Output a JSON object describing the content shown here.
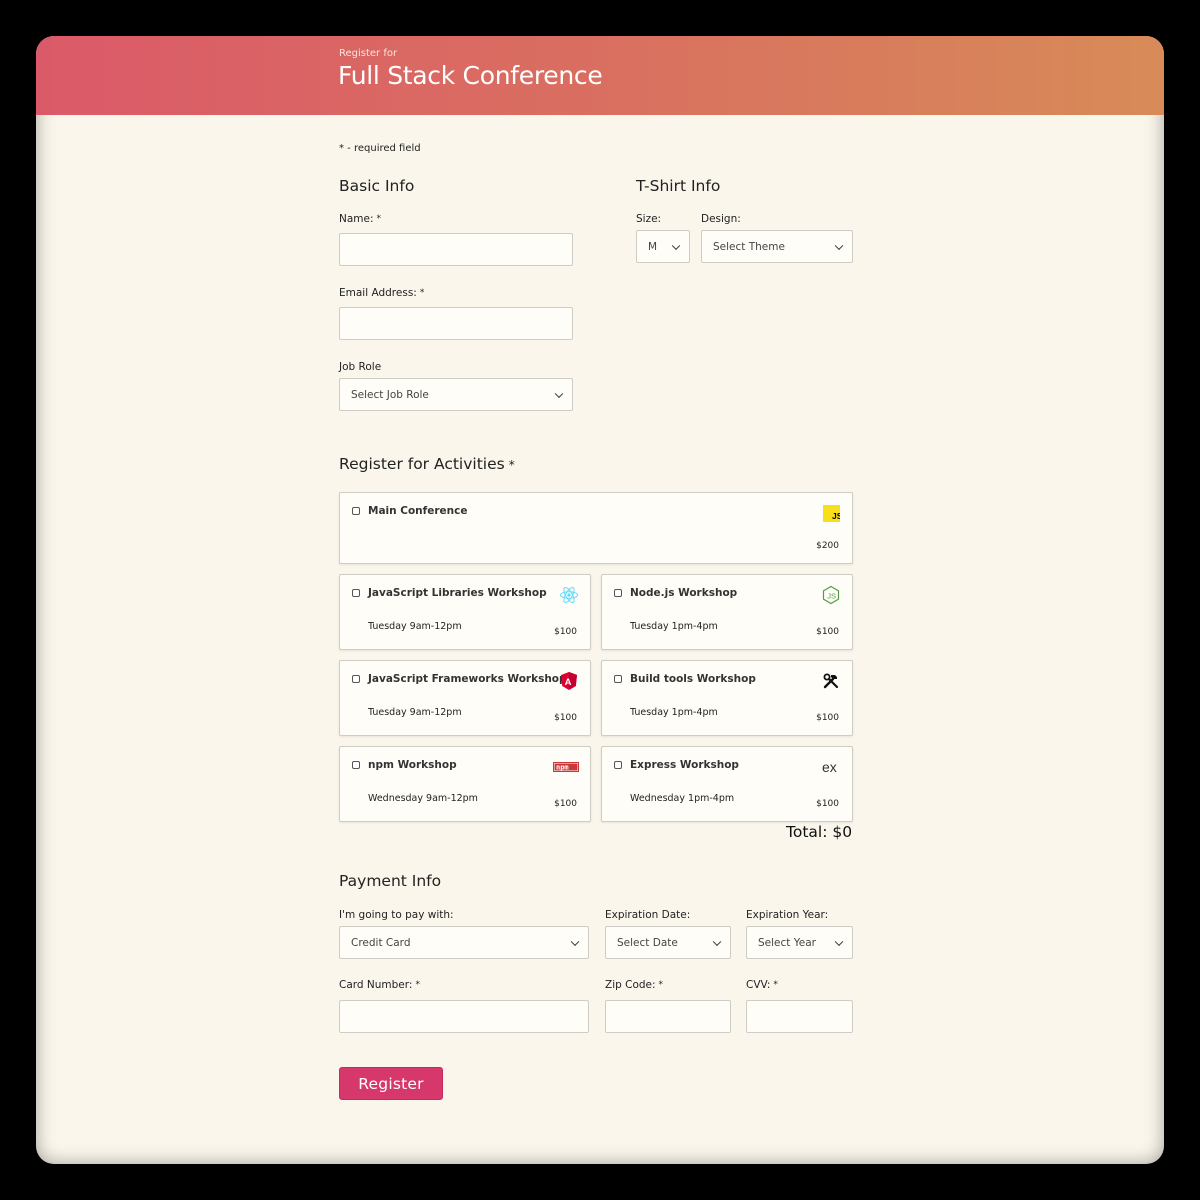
{
  "header": {
    "pre_title": "Register for",
    "title": "Full Stack Conference"
  },
  "required_note": "* - required field",
  "basic_info": {
    "title": "Basic Info",
    "name_label": "Name:",
    "email_label": "Email Address:",
    "job_role_label": "Job Role",
    "job_role_value": "Select Job Role"
  },
  "tshirt": {
    "title": "T-Shirt Info",
    "size_label": "Size:",
    "size_value": "M",
    "design_label": "Design:",
    "design_value": "Select Theme"
  },
  "activities": {
    "title": "Register for Activities",
    "items": [
      {
        "name": "Main Conference",
        "time": "",
        "price": "$200",
        "icon": "javascript-icon"
      },
      {
        "name": "JavaScript Libraries Workshop",
        "time": "Tuesday 9am-12pm",
        "price": "$100",
        "icon": "react-icon"
      },
      {
        "name": "Node.js Workshop",
        "time": "Tuesday 1pm-4pm",
        "price": "$100",
        "icon": "nodejs-icon"
      },
      {
        "name": "JavaScript Frameworks Workshop",
        "time": "Tuesday 9am-12pm",
        "price": "$100",
        "icon": "angular-icon"
      },
      {
        "name": "Build tools Workshop",
        "time": "Tuesday 1pm-4pm",
        "price": "$100",
        "icon": "tools-icon"
      },
      {
        "name": "npm Workshop",
        "time": "Wednesday 9am-12pm",
        "price": "$100",
        "icon": "npm-icon"
      },
      {
        "name": "Express Workshop",
        "time": "Wednesday 1pm-4pm",
        "price": "$100",
        "icon": "express-icon"
      }
    ],
    "total": "Total: $0"
  },
  "payment": {
    "title": "Payment Info",
    "method_label": "I'm going to pay with:",
    "method_value": "Credit Card",
    "exp_date_label": "Expiration Date:",
    "exp_date_value": "Select Date",
    "exp_year_label": "Expiration Year:",
    "exp_year_value": "Select Year",
    "card_label": "Card Number:",
    "zip_label": "Zip Code:",
    "cvv_label": "CVV:"
  },
  "register_button": "Register",
  "required_marker": "*",
  "colors": {
    "header_start": "#db5a69",
    "header_end": "#d88b58",
    "button": "#d6386b",
    "background": "#faf6ec"
  }
}
